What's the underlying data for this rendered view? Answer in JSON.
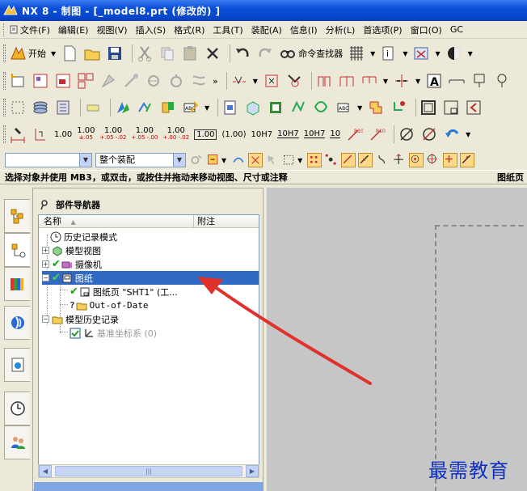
{
  "window": {
    "title": "NX 8 - 制图 - [_model8.prt  (修改的) ]"
  },
  "menubar": {
    "items": [
      "文件(F)",
      "编辑(E)",
      "视图(V)",
      "插入(S)",
      "格式(R)",
      "工具(T)",
      "装配(A)",
      "信息(I)",
      "分析(L)",
      "首选项(P)",
      "窗口(O)",
      "GC"
    ]
  },
  "toolbar1": {
    "start_label": "开始",
    "command_finder_label": "命令查找器"
  },
  "dim_toolbar": {
    "values": [
      "1.00",
      "1.00",
      "1.00",
      "1.00",
      "1.00"
    ],
    "tol_labels": [
      "±.05",
      "+.05 -.02",
      "+.05 -.00",
      "+.00 -.02"
    ],
    "box_value": "1.00",
    "paren_value": "(1.00)",
    "fit_h7": "10H7",
    "fit_h7_a": "10H7",
    "fit_h7_b": "10H7",
    "ten": "10"
  },
  "selection": {
    "filter_value": "",
    "scope_value": "整个装配"
  },
  "status": {
    "message": "选择对象并使用 MB3，或双击，或按住并拖动来移动视图、尺寸或注释",
    "right_text": "图纸页"
  },
  "navigator": {
    "title": "部件导航器",
    "col_name": "名称",
    "col_note": "附注",
    "rows": [
      {
        "label": "历史记录模式"
      },
      {
        "label": "模型视图"
      },
      {
        "label": "摄像机"
      },
      {
        "label": "图纸"
      },
      {
        "label": "图纸页 \"SHT1\" (工..."
      },
      {
        "label": "Out-of-Date"
      },
      {
        "label": "模型历史记录"
      },
      {
        "label": "基准坐标系 (0)"
      }
    ]
  },
  "watermark": "最需教育",
  "colors": {
    "title_bar": "#0a4fd8",
    "selected_row": "#316ac5",
    "canvas": "#c6c6c6",
    "arrow": "#e0322c",
    "watermark": "#1030c0"
  }
}
